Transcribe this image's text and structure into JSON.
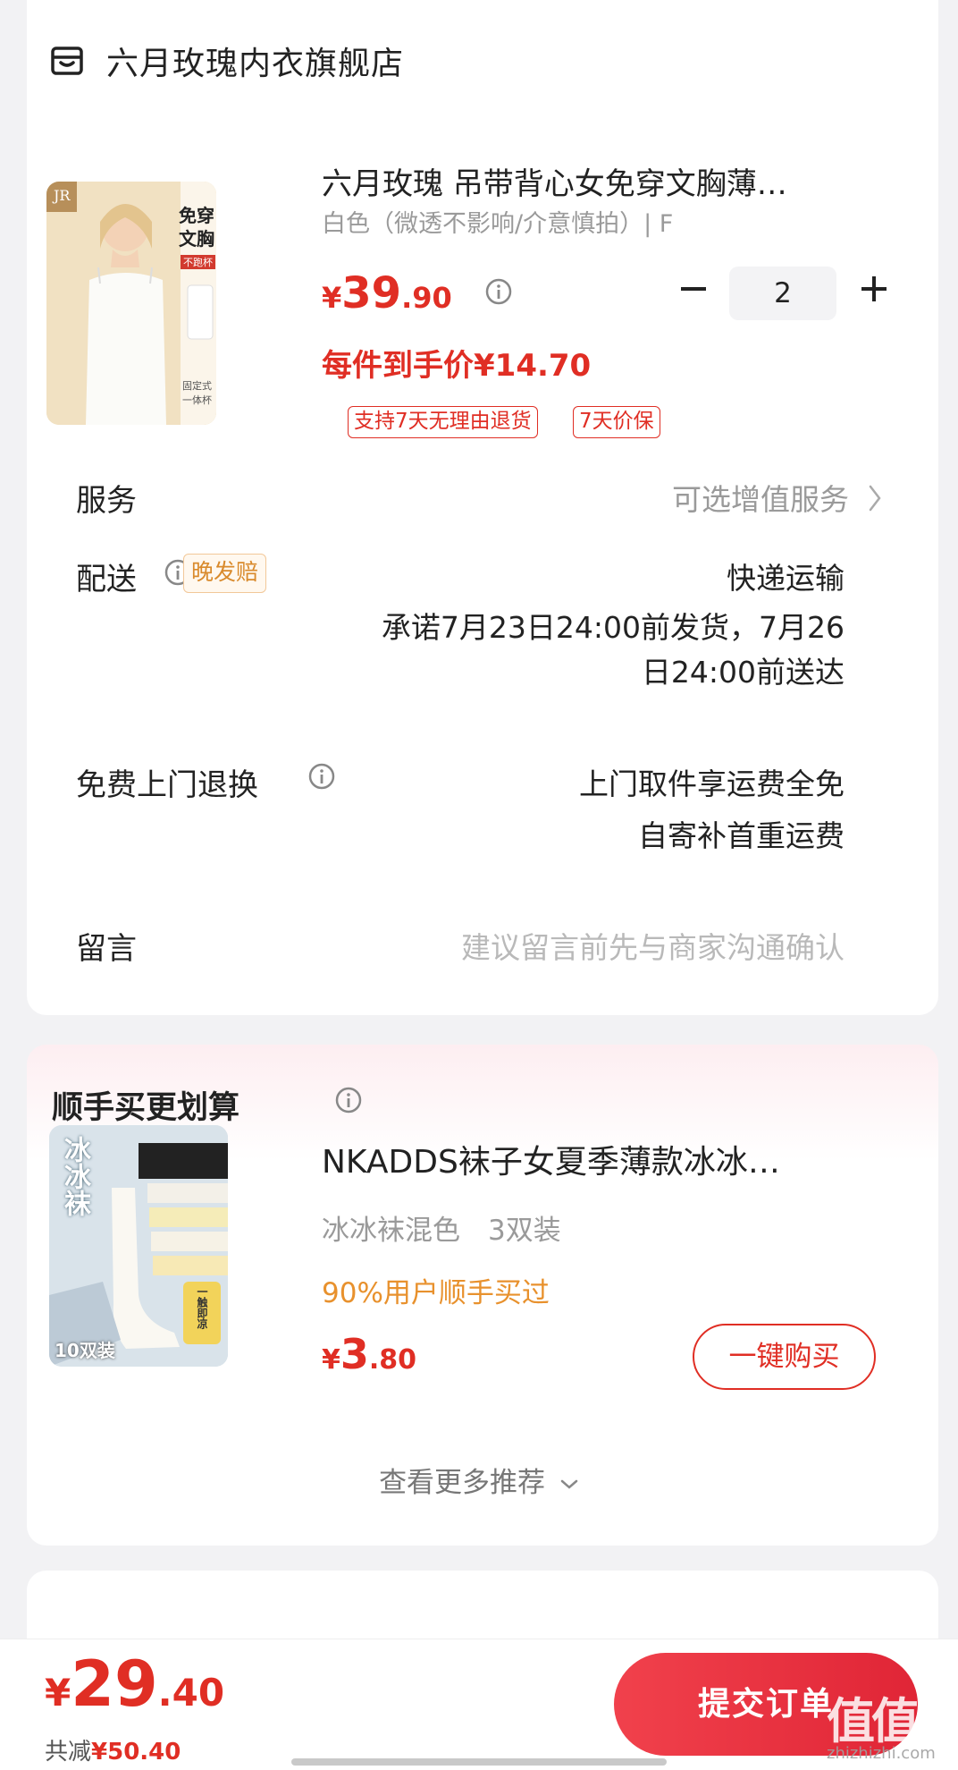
{
  "store": {
    "name": "六月玫瑰内衣旗舰店",
    "icon": "store-icon"
  },
  "product": {
    "title": "六月玫瑰 吊带背心女免穿文胸薄…",
    "spec": "白色（微透不影响/介意慎拍）| F",
    "image_text": {
      "brand": "JR",
      "headline_1": "免穿",
      "headline_2": "文胸",
      "badge": "不跑杯",
      "caption_1": "固定式",
      "caption_2": "一体杯"
    },
    "price_yen": "¥",
    "price_int": "39",
    "price_dec": ".90",
    "quantity": "2",
    "unit_price": "每件到手价¥14.70",
    "tags": [
      "支持7天无理由退货",
      "7天价保"
    ]
  },
  "service": {
    "label": "服务",
    "value": "可选增值服务"
  },
  "delivery": {
    "label": "配送",
    "badge": "晚发赔",
    "method": "快递运输",
    "promise_line1": "承诺7月23日24:00前发货，7月26",
    "promise_line2": "日24:00前送达"
  },
  "free_return": {
    "label": "免费上门退换",
    "line1": "上门取件享运费全免",
    "line2": "自寄补首重运费"
  },
  "message": {
    "label": "留言",
    "placeholder": "建议留言前先与商家沟通确认"
  },
  "recommend": {
    "title": "顺手买更划算",
    "item_name": "NKADDS袜子女夏季薄款冰冰…",
    "item_spec": "冰冰袜混色　3双装",
    "bought": "90%用户顺手买过",
    "price_yen": "¥",
    "price_int": "3",
    "price_dec": ".80",
    "buy_label": "一键购买",
    "image_text": {
      "title": "冰冰袜",
      "pack": "10双装",
      "side": "一触即凉"
    },
    "more_label": "查看更多推荐"
  },
  "footer": {
    "total_yen": "¥",
    "total_int": "29",
    "total_dec": ".40",
    "saved_prefix": "共减",
    "saved_amount": "¥50.40",
    "submit_label": "提交订单",
    "watermark": "值值值",
    "watermark_sub": "zhizhizhi.com"
  },
  "colors": {
    "accent": "#e02e24",
    "orange": "#e8912d",
    "muted": "#9a9a9a",
    "background": "#f2f2f4"
  }
}
